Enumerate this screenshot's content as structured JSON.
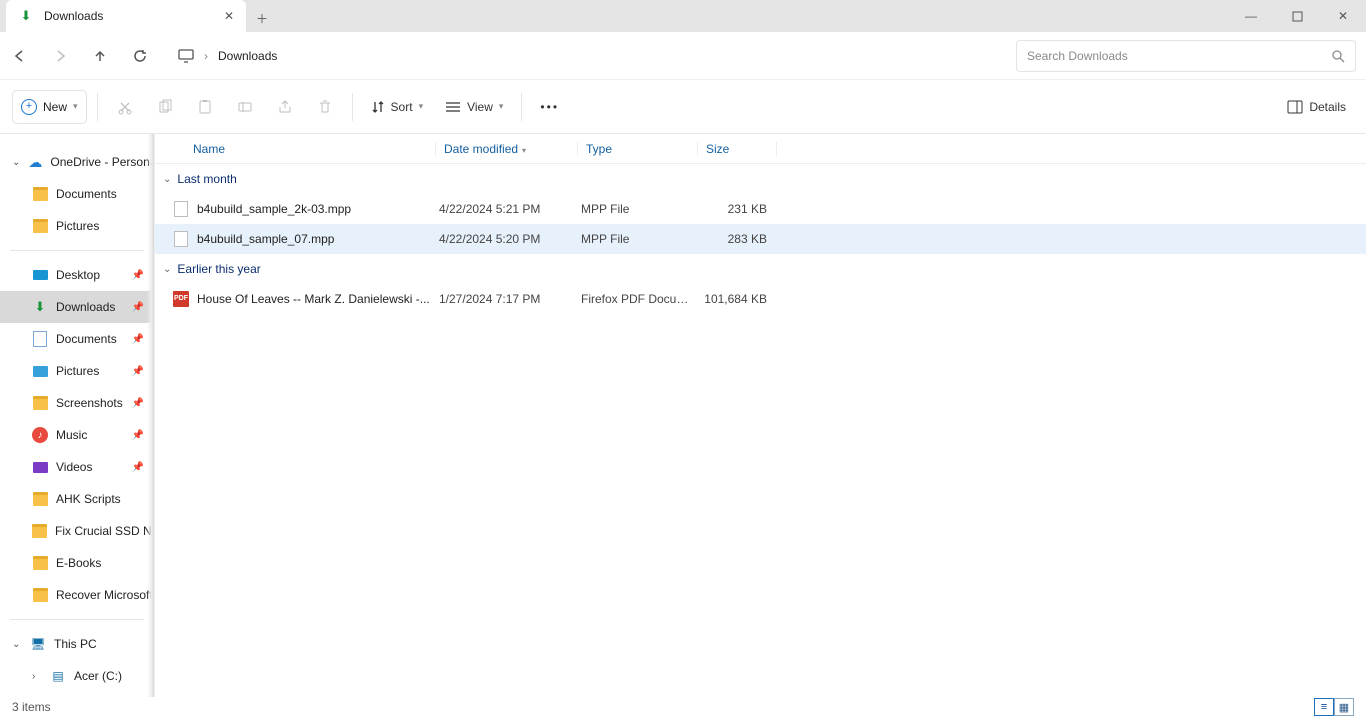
{
  "tab": {
    "title": "Downloads"
  },
  "address": {
    "path": "Downloads",
    "searchPlaceholder": "Search Downloads"
  },
  "toolbar": {
    "new": "New",
    "sort": "Sort",
    "view": "View",
    "details": "Details"
  },
  "sidebar": {
    "onedrive": "OneDrive - Personal",
    "onedriveDocs": "Documents",
    "onedrivePics": "Pictures",
    "quick": {
      "desktop": "Desktop",
      "downloads": "Downloads",
      "documents": "Documents",
      "pictures": "Pictures",
      "screenshots": "Screenshots",
      "music": "Music",
      "videos": "Videos",
      "ahk": "AHK Scripts",
      "fixssd": "Fix Crucial SSD Not Showing Up",
      "ebooks": "E-Books",
      "recover": "Recover Microsoft"
    },
    "thispc": "This PC",
    "acer": "Acer (C:)"
  },
  "columns": {
    "name": "Name",
    "date": "Date modified",
    "type": "Type",
    "size": "Size"
  },
  "groups": {
    "lastMonth": "Last month",
    "earlierYear": "Earlier this year"
  },
  "files": {
    "f0": {
      "name": "b4ubuild_sample_2k-03.mpp",
      "date": "4/22/2024 5:21 PM",
      "type": "MPP File",
      "size": "231 KB"
    },
    "f1": {
      "name": "b4ubuild_sample_07.mpp",
      "date": "4/22/2024 5:20 PM",
      "type": "MPP File",
      "size": "283 KB"
    },
    "f2": {
      "name": "House Of Leaves -- Mark Z. Danielewski -...",
      "date": "1/27/2024 7:17 PM",
      "type": "Firefox PDF Docu…",
      "size": "101,684 KB"
    }
  },
  "status": {
    "count": "3 items"
  }
}
